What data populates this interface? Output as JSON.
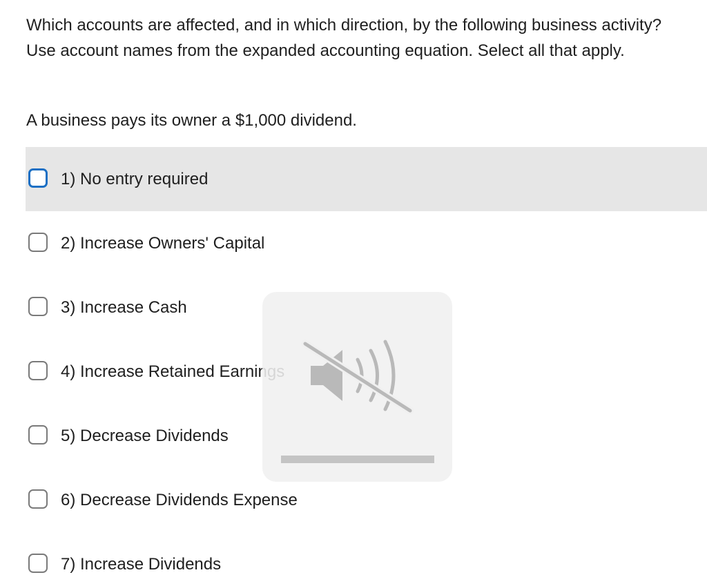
{
  "question": {
    "prompt": "Which accounts are affected, and in which direction, by the following business activity?  Use  account names from the expanded accounting equation.  Select all that apply.",
    "scenario": "A business pays its owner a $1,000 dividend."
  },
  "options": [
    {
      "label": "1)  No entry required",
      "checked": false
    },
    {
      "label": "2)  Increase Owners' Capital",
      "checked": false
    },
    {
      "label": "3)  Increase Cash",
      "checked": false
    },
    {
      "label": "4)  Increase Retained Earnings",
      "checked": false
    },
    {
      "label": "5)  Decrease Dividends",
      "checked": false
    },
    {
      "label": "6)  Decrease Dividends Expense",
      "checked": false
    },
    {
      "label": "7)  Increase Dividends",
      "checked": false
    }
  ],
  "overlay": {
    "icon": "speaker-muted-icon",
    "volume_level": 0
  },
  "colors": {
    "focus_border": "#1a6fc4",
    "checkbox_border": "#7a7a7a",
    "highlight_row": "#e6e6e6"
  }
}
